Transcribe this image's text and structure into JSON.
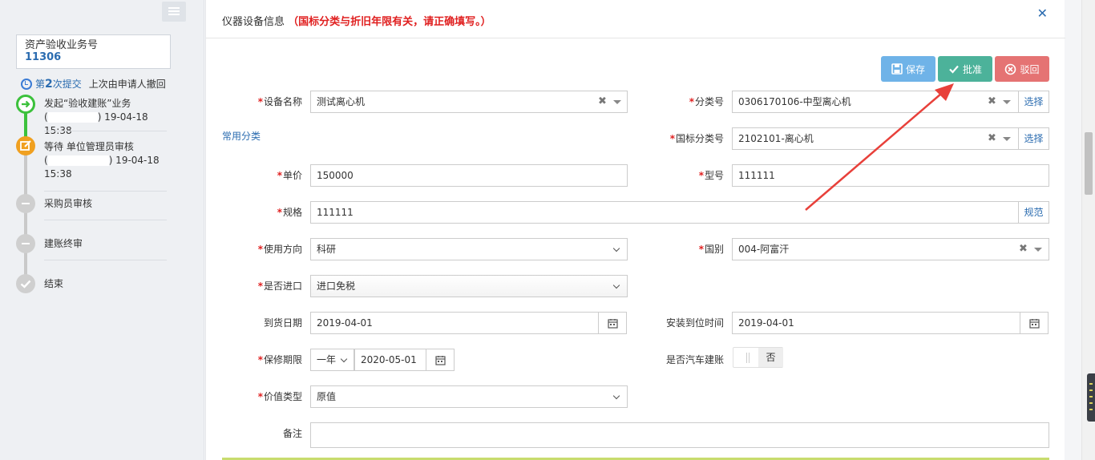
{
  "sidebar": {
    "biz_label": "资产验收业务号",
    "biz_no": "11306",
    "submit_prefix": "第",
    "submit_num": "2",
    "submit_suffix": "次提交",
    "submit_note": "上次由申请人撤回",
    "steps": [
      {
        "line1": "发起“验收建账”业务",
        "paren_open": "(",
        "time": ") 19-04-18 15:38",
        "status": "done"
      },
      {
        "line1": "等待 单位管理员审核",
        "paren_open": "(",
        "time": ") 19-04-18",
        "time2": "15:38",
        "status": "current"
      },
      {
        "line1": "采购员审核",
        "status": "pending"
      },
      {
        "line1": "建账终审",
        "status": "pending"
      },
      {
        "line1": "结束",
        "status": "end"
      }
    ]
  },
  "panel": {
    "title": "仪器设备信息",
    "warning": "（国标分类与折旧年限有关，请正确填写。）",
    "buttons": {
      "save": "保存",
      "approve": "批准",
      "reject": "驳回"
    },
    "common_category_link": "常用分类"
  },
  "form": {
    "device_name": {
      "label": "设备名称",
      "value": "测试离心机"
    },
    "category_no": {
      "label": "分类号",
      "value": "0306170106-中型离心机",
      "addon": "选择"
    },
    "gb_category_no": {
      "label": "国标分类号",
      "value": "2102101-离心机",
      "addon": "选择"
    },
    "unit_price": {
      "label": "单价",
      "value": "150000"
    },
    "model": {
      "label": "型号",
      "value": "111111"
    },
    "spec": {
      "label": "规格",
      "value": "111111",
      "addon": "规范"
    },
    "usage": {
      "label": "使用方向",
      "value": "科研"
    },
    "country": {
      "label": "国别",
      "value": "004-阿富汗"
    },
    "imported": {
      "label": "是否进口",
      "value": "进口免税"
    },
    "arrival_date": {
      "label": "到货日期",
      "value": "2019-04-01"
    },
    "install_date": {
      "label": "安装到位时间",
      "value": "2019-04-01"
    },
    "warranty": {
      "label": "保修期限",
      "period": "一年",
      "date": "2020-05-01"
    },
    "car_account": {
      "label": "是否汽车建账",
      "value": "否"
    },
    "value_type": {
      "label": "价值类型",
      "value": "原值"
    },
    "remark": {
      "label": "备注",
      "value": ""
    }
  },
  "colors": {
    "accent": "#2b6cb0",
    "required": "#e02020",
    "save": "#6fb3e8",
    "approve": "#4cb29a",
    "reject": "#e57373",
    "arrow": "#e8403a"
  }
}
